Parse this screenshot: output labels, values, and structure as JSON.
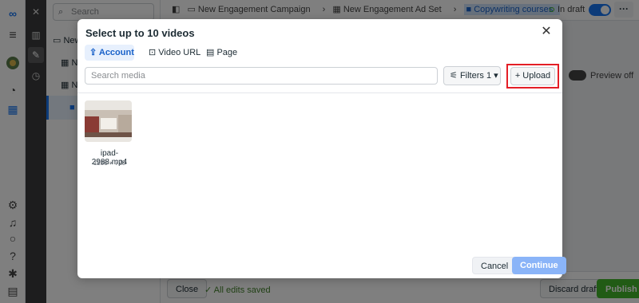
{
  "left_nav": {
    "icons": [
      "meta-logo-icon",
      "menu-icon",
      "account-avatar-icon",
      "dashboard-icon",
      "table-icon",
      "settings-icon",
      "bell-icon",
      "search-icon",
      "help-icon",
      "bug-icon",
      "reports-icon"
    ]
  },
  "tree": {
    "search_placeholder": "Search",
    "items": [
      "New",
      "N",
      "N"
    ]
  },
  "topbar": {
    "breadcrumbs": [
      "New Engagement Campaign",
      "New Engagement Ad Set",
      "Copywriting courses"
    ],
    "status": "In draft"
  },
  "background": {
    "preview_label": "Preview off"
  },
  "bottombar": {
    "close_label": "Close",
    "saved_text": "All edits saved",
    "discard_label": "Discard draft",
    "publish_label": "Publish"
  },
  "modal": {
    "title": "Select up to 10 videos",
    "tabs": [
      {
        "label": "Account",
        "icon": "upload-icon",
        "active": true
      },
      {
        "label": "Video URL",
        "icon": "video-url-icon",
        "active": false
      },
      {
        "label": "Page",
        "icon": "page-icon",
        "active": false
      }
    ],
    "search_placeholder": "Search media",
    "filters_label": "Filters 1",
    "upload_label": "+ Upload",
    "video": {
      "name": "ipad-2988.mp4",
      "dims": "1280 × 720"
    },
    "cancel_label": "Cancel",
    "continue_label": "Continue"
  }
}
